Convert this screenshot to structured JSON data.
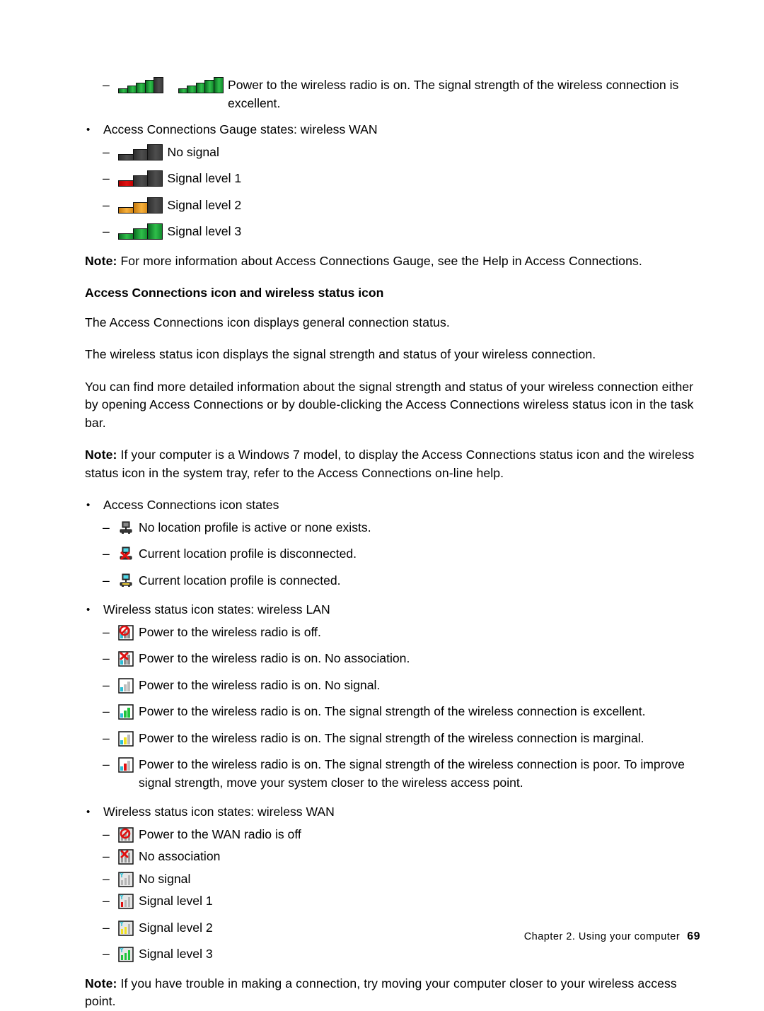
{
  "page": {
    "footer_text": "Chapter 2. Using your computer",
    "page_number": "69"
  },
  "colors": {
    "green": "#2fbf4a",
    "gray": "#4d4d4d",
    "red": "#e01010",
    "orange": "#f7b13c"
  },
  "top_item": {
    "dash": "–",
    "text": "Power to the wireless radio is on. The signal strength of the wireless connection is excellent."
  },
  "gauge_wan": {
    "bullet": "•",
    "title": "Access Connections Gauge states: wireless WAN",
    "items": [
      {
        "dash": "–",
        "label": "No signal",
        "icon": "gauge-no-signal"
      },
      {
        "dash": "–",
        "label": "Signal level 1",
        "icon": "gauge-level-1"
      },
      {
        "dash": "–",
        "label": "Signal level 2",
        "icon": "gauge-level-2"
      },
      {
        "dash": "–",
        "label": "Signal level 3",
        "icon": "gauge-level-3"
      }
    ]
  },
  "note1": {
    "label": "Note:",
    "text": " For more information about Access Connections Gauge, see the Help in Access Connections."
  },
  "section_heading": "Access Connections icon and wireless status icon",
  "para1": "The Access Connections icon displays general connection status.",
  "para2": "The wireless status icon displays the signal strength and status of your wireless connection.",
  "para3": "You can find more detailed information about the signal strength and status of your wireless connection either by opening Access Connections or by double-clicking the Access Connections wireless status icon in the task bar.",
  "note2": {
    "label": "Note:",
    "text": " If your computer is a Windows 7 model, to display the Access Connections status icon and the wireless status icon in the system tray, refer to the Access Connections on-line help."
  },
  "ac_icon_states": {
    "bullet": "•",
    "title": "Access Connections icon states",
    "items": [
      {
        "dash": "–",
        "label": "No location profile is active or none exists.",
        "icon": "computer-no-profile-icon"
      },
      {
        "dash": "–",
        "label": "Current location profile is disconnected.",
        "icon": "computer-disconnected-icon"
      },
      {
        "dash": "–",
        "label": "Current location profile is connected.",
        "icon": "computer-connected-icon"
      }
    ]
  },
  "wireless_lan": {
    "bullet": "•",
    "title": "Wireless status icon states: wireless LAN",
    "items": [
      {
        "dash": "–",
        "label": "Power to the wireless radio is off.",
        "icon": "lan-radio-off-icon"
      },
      {
        "dash": "–",
        "label": "Power to the wireless radio is on. No association.",
        "icon": "lan-no-association-icon"
      },
      {
        "dash": "–",
        "label": "Power to the wireless radio is on. No signal.",
        "icon": "lan-no-signal-icon"
      },
      {
        "dash": "–",
        "label": "Power to the wireless radio is on. The signal strength of the wireless connection is excellent.",
        "icon": "lan-excellent-icon"
      },
      {
        "dash": "–",
        "label": "Power to the wireless radio is on. The signal strength of the wireless connection is marginal.",
        "icon": "lan-marginal-icon"
      },
      {
        "dash": "–",
        "label": "Power to the wireless radio is on. The signal strength of the wireless connection is poor. To improve signal strength, move your system closer to the wireless access point.",
        "icon": "lan-poor-icon"
      }
    ]
  },
  "wireless_wan": {
    "bullet": "•",
    "title": "Wireless status icon states: wireless WAN",
    "items": [
      {
        "dash": "–",
        "label": "Power to the WAN radio is off",
        "icon": "wan-radio-off-icon"
      },
      {
        "dash": "–",
        "label": "No association",
        "icon": "wan-no-association-icon"
      },
      {
        "dash": "–",
        "label": "No signal",
        "icon": "wan-no-signal-icon"
      },
      {
        "dash": "–",
        "label": "Signal level 1",
        "icon": "wan-level-1-icon"
      },
      {
        "dash": "–",
        "label": "Signal level 2",
        "icon": "wan-level-2-icon"
      },
      {
        "dash": "–",
        "label": "Signal level 3",
        "icon": "wan-level-3-icon"
      }
    ]
  },
  "note3": {
    "label": "Note:",
    "text": " If you have trouble in making a connection, try moving your computer closer to your wireless access point."
  }
}
